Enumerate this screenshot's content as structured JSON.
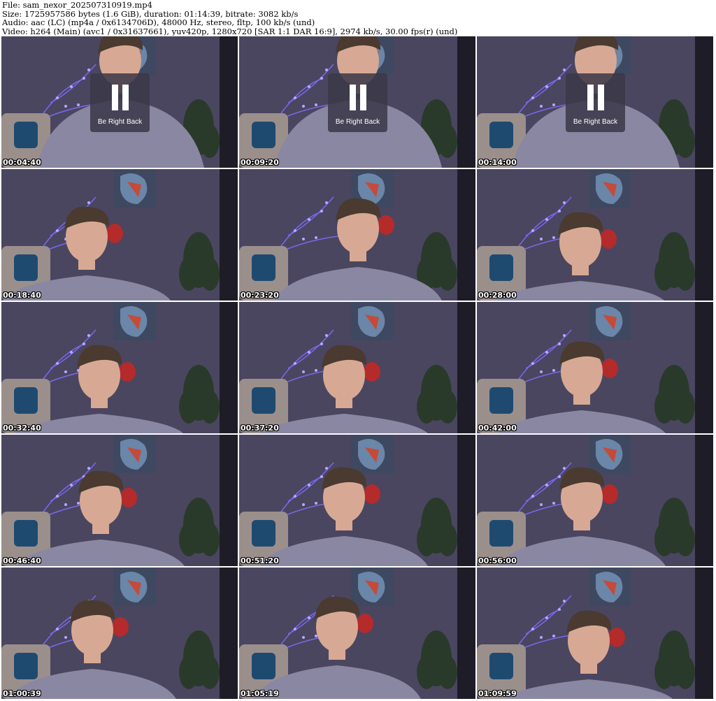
{
  "header": {
    "file": "File: sam_nexor_202507310919.mp4",
    "size": "Size: 1725957586 bytes (1.6 GiB), duration: 01:14:39, bitrate: 3082 kb/s",
    "audio": "Audio: aac (LC) (mp4a / 0x6134706D), 48000 Hz, stereo, fltp, 100 kb/s (und)",
    "video": "Video: h264 (Main) (avc1 / 0x31637661), yuv420p, 1280x720 [SAR 1:1 DAR 16:9], 2974 kb/s, 30.00 fps(r) (und)"
  },
  "overlay": {
    "brb_label": "Be Right Back",
    "pause_icon": "pause-icon"
  },
  "thumbnails": [
    {
      "timestamp": "00:04:40",
      "brb": true
    },
    {
      "timestamp": "00:09:20",
      "brb": true
    },
    {
      "timestamp": "00:14:00",
      "brb": true
    },
    {
      "timestamp": "00:18:40",
      "brb": false
    },
    {
      "timestamp": "00:23:20",
      "brb": false
    },
    {
      "timestamp": "00:28:00",
      "brb": false
    },
    {
      "timestamp": "00:32:40",
      "brb": false
    },
    {
      "timestamp": "00:37:20",
      "brb": false
    },
    {
      "timestamp": "00:42:00",
      "brb": false
    },
    {
      "timestamp": "00:46:40",
      "brb": false
    },
    {
      "timestamp": "00:51:20",
      "brb": false
    },
    {
      "timestamp": "00:56:00",
      "brb": false
    },
    {
      "timestamp": "01:00:39",
      "brb": false
    },
    {
      "timestamp": "01:05:19",
      "brb": false
    },
    {
      "timestamp": "01:09:59",
      "brb": false
    }
  ],
  "colors": {
    "wall": "#4a4660",
    "shirt": "#8a87a2",
    "hair": "#4a3a30",
    "skin": "#d7a994",
    "chair": "#9b8f8c",
    "pillow": "#1f4a70",
    "plant": "#2a3a2a",
    "light": "#7e6cff",
    "painting": "#3e4860",
    "cam_dot": "#23c342"
  }
}
